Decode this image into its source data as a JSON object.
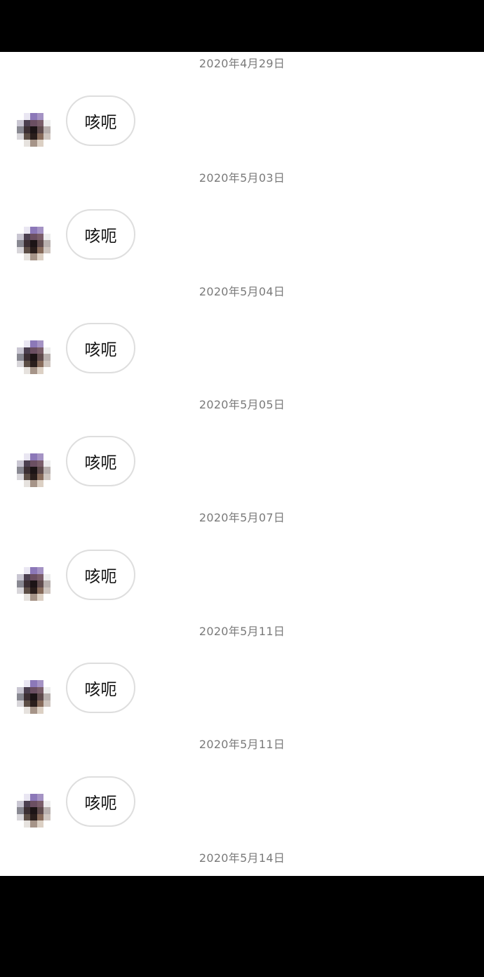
{
  "messages": [
    {
      "date": "2020年4月29日",
      "text": "咳呃"
    },
    {
      "date": "2020年5月03日",
      "text": "咳呃"
    },
    {
      "date": "2020年5月04日",
      "text": "咳呃"
    },
    {
      "date": "2020年5月05日",
      "text": "咳呃"
    },
    {
      "date": "2020年5月07日",
      "text": "咳呃"
    },
    {
      "date": "2020年5月11日",
      "text": "咳呃"
    },
    {
      "date": "2020年5月11日",
      "text": "咳呃"
    }
  ],
  "trailing_date": "2020年5月14日",
  "colors": {
    "background": "#ffffff",
    "frame": "#000000",
    "timestamp": "#7a7a7a",
    "bubble_border": "#dedede",
    "message_text": "#111111"
  },
  "avatar_icon": "pixelated-avatar-icon"
}
